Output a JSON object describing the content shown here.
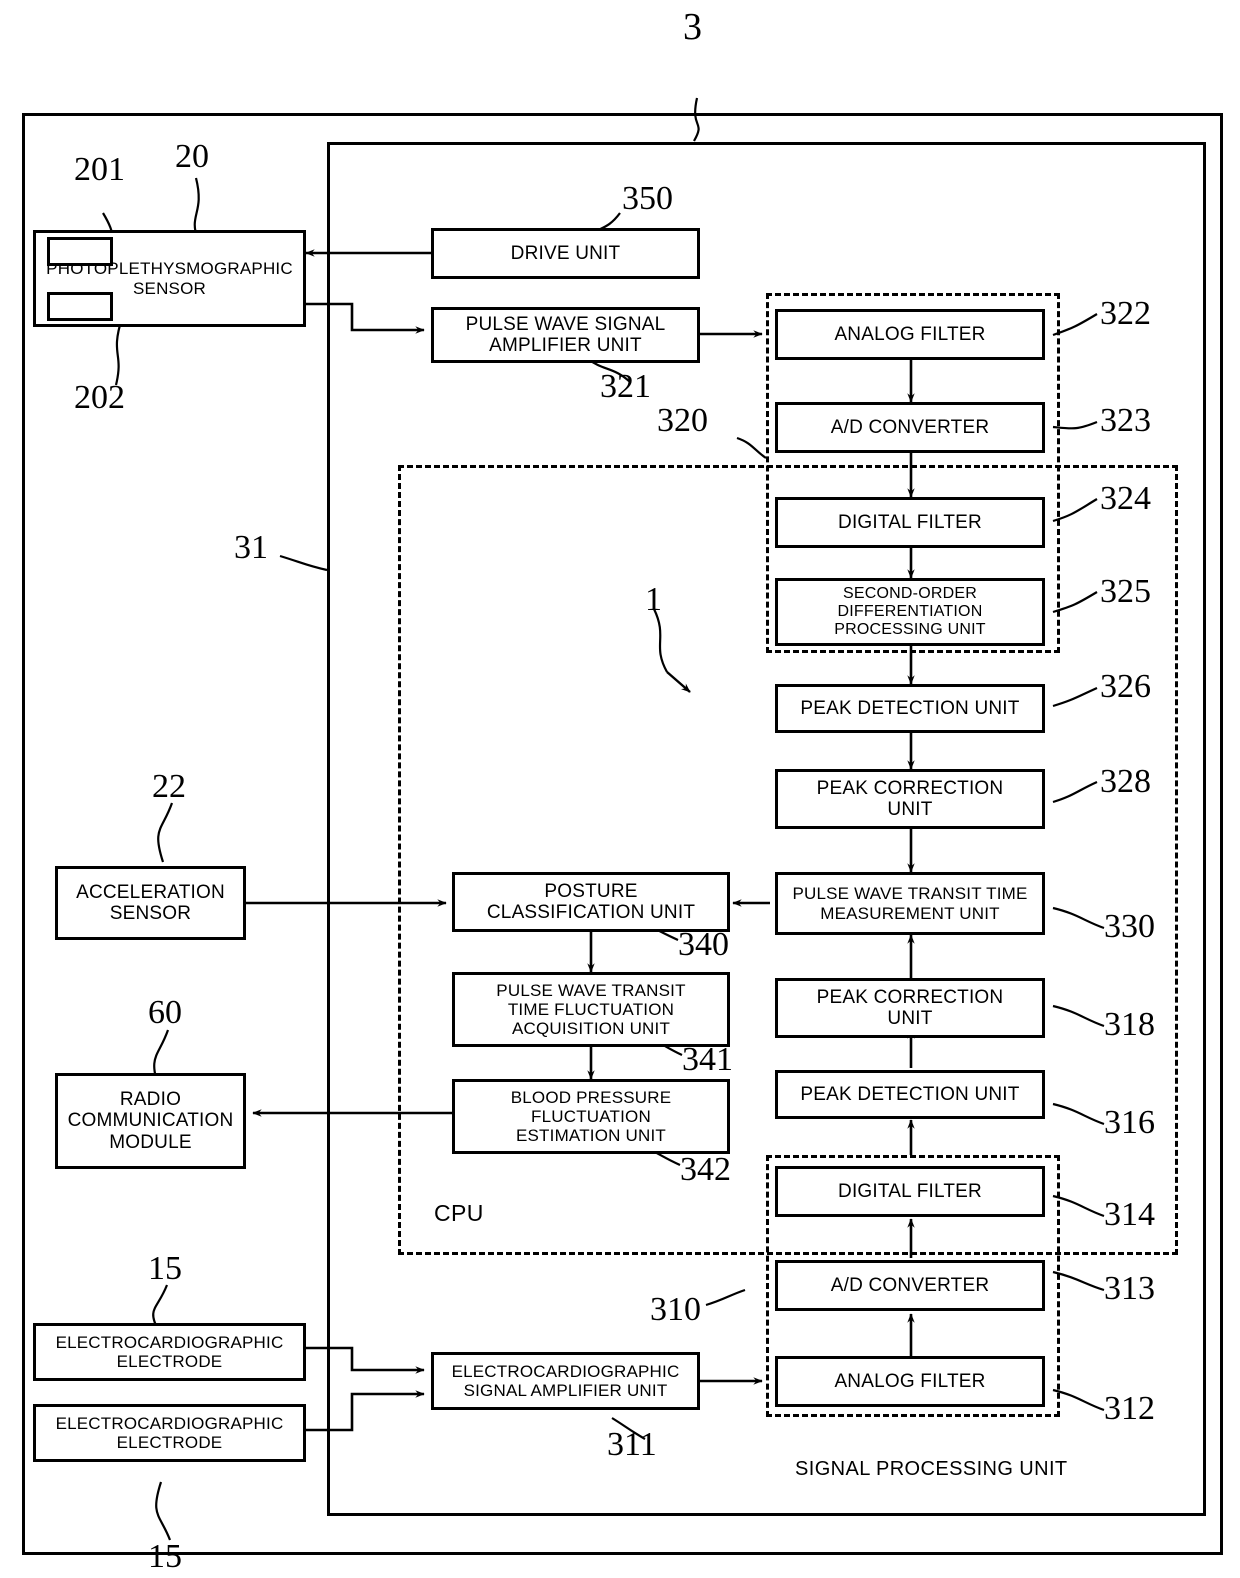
{
  "figure": {
    "top_numeral": "3",
    "system_numeral": "1",
    "device_numeral": "31",
    "cpu_label": "CPU",
    "signal_processing_label": "SIGNAL PROCESSING UNIT"
  },
  "blocks": {
    "photoplethysmographic_sensor": {
      "label": "PHOTOPLETHYSMOGRAPHIC\nSENSOR",
      "ref": "20",
      "sub_top_ref": "201",
      "sub_bottom_ref": "202"
    },
    "drive_unit": {
      "label": "DRIVE UNIT",
      "ref": "350"
    },
    "pulse_wave_signal_amplifier_unit": {
      "label": "PULSE WAVE SIGNAL\nAMPLIFIER UNIT",
      "ref": "321"
    },
    "analog_filter_pw": {
      "label": "ANALOG FILTER",
      "ref": "322"
    },
    "ad_converter_pw": {
      "label": "A/D CONVERTER",
      "ref": "323"
    },
    "digital_filter_pw": {
      "label": "DIGITAL FILTER",
      "ref": "324"
    },
    "second_order_differentiation_processing_unit": {
      "label": "SECOND-ORDER\nDIFFERENTIATION\nPROCESSING UNIT",
      "ref": "325"
    },
    "peak_detection_unit_pw": {
      "label": "PEAK DETECTION UNIT",
      "ref": "326"
    },
    "peak_correction_unit_pw": {
      "label": "PEAK CORRECTION\nUNIT",
      "ref": "328"
    },
    "pulse_wave_transit_time_measurement_unit": {
      "label": "PULSE WAVE TRANSIT TIME\nMEASUREMENT UNIT",
      "ref": "330"
    },
    "peak_correction_unit_ecg": {
      "label": "PEAK CORRECTION\nUNIT",
      "ref": "318"
    },
    "peak_detection_unit_ecg": {
      "label": "PEAK DETECTION UNIT",
      "ref": "316"
    },
    "digital_filter_ecg": {
      "label": "DIGITAL FILTER",
      "ref": "314"
    },
    "ad_converter_ecg": {
      "label": "A/D CONVERTER",
      "ref": "313"
    },
    "analog_filter_ecg": {
      "label": "ANALOG FILTER",
      "ref": "312"
    },
    "electrocardiographic_signal_amplifier_unit": {
      "label": "ELECTROCARDIOGRAPHIC\nSIGNAL AMPLIFIER UNIT",
      "ref": "311"
    },
    "electrocardiographic_electrode_top": {
      "label": "ELECTROCARDIOGRAPHIC\nELECTRODE",
      "ref": "15"
    },
    "electrocardiographic_electrode_bottom": {
      "label": "ELECTROCARDIOGRAPHIC\nELECTRODE",
      "ref": "15"
    },
    "acceleration_sensor": {
      "label": "ACCELERATION\nSENSOR",
      "ref": "22"
    },
    "radio_communication_module": {
      "label": "RADIO\nCOMMUNICATION\nMODULE",
      "ref": "60"
    },
    "posture_classification_unit": {
      "label": "POSTURE\nCLASSIFICATION UNIT",
      "ref": "340"
    },
    "pulse_wave_transit_time_fluctuation_acquisition_unit": {
      "label": "PULSE WAVE TRANSIT\nTIME FLUCTUATION\nACQUISITION UNIT",
      "ref": "341"
    },
    "blood_pressure_fluctuation_estimation_unit": {
      "label": "BLOOD PRESSURE\nFLUCTUATION\nESTIMATION UNIT",
      "ref": "342"
    }
  },
  "group_refs": {
    "pulse_wave_front_end": "320",
    "ecg_front_end": "310"
  },
  "colors": {
    "line": "#000000",
    "background": "#ffffff"
  }
}
